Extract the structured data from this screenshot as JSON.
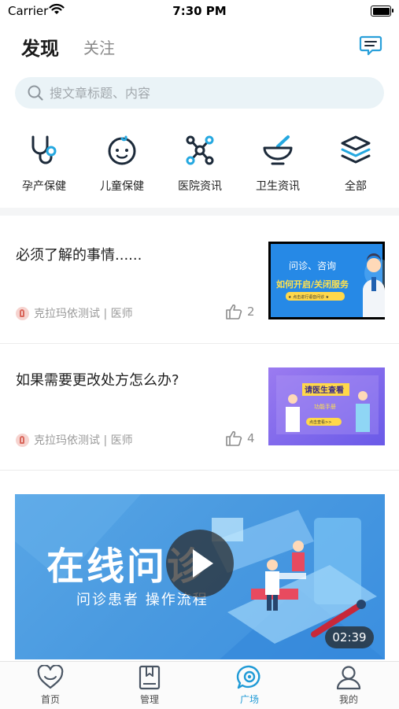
{
  "status_bar": {
    "carrier": "Carrier",
    "time": "7:30 PM"
  },
  "header": {
    "tabs": [
      {
        "label": "发现",
        "active": true
      },
      {
        "label": "关注",
        "active": false
      }
    ]
  },
  "search": {
    "placeholder": "搜文章标题、内容",
    "value": ""
  },
  "categories": [
    {
      "label": "孕产保健",
      "icon": "stethoscope-icon"
    },
    {
      "label": "儿童保健",
      "icon": "baby-face-icon"
    },
    {
      "label": "医院资讯",
      "icon": "molecule-icon"
    },
    {
      "label": "卫生资讯",
      "icon": "mortar-pestle-icon"
    },
    {
      "label": "全部",
      "icon": "layers-icon"
    }
  ],
  "articles": [
    {
      "title": "必须了解的事情......",
      "author": "克拉玛依测试 | 医师",
      "likes": "2",
      "thumb": {
        "line1": "问诊、咨询",
        "line2": "如何开启/关闭服务",
        "badge": "★ 点击进行语音问诊 ★"
      }
    },
    {
      "title": "如果需要更改处方怎么办?",
      "author": "克拉玛依测试 | 医师",
      "likes": "4",
      "thumb": {
        "line1": "请医生查看",
        "line2": "功能手册",
        "badge": "点击查看>>"
      }
    }
  ],
  "video": {
    "title": "在线问诊",
    "subtitle": "问诊患者  操作流程",
    "duration": "02:39"
  },
  "tabbar": [
    {
      "label": "首页",
      "icon": "heart-icon",
      "active": false
    },
    {
      "label": "管理",
      "icon": "book-icon",
      "active": false
    },
    {
      "label": "广场",
      "icon": "chat-bubble-icon",
      "active": true
    },
    {
      "label": "我的",
      "icon": "person-icon",
      "active": false
    }
  ],
  "colors": {
    "accent": "#1f9ad6",
    "icon_dark": "#1c2a3a",
    "icon_blue": "#25a8e0",
    "search_bg": "#eaf3f7"
  }
}
